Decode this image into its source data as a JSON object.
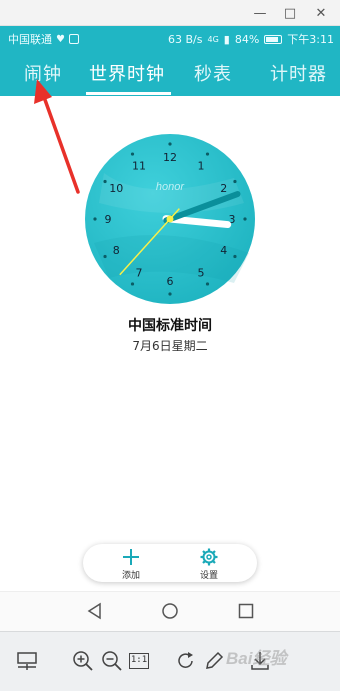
{
  "window": {
    "minimize_glyph": "—",
    "maximize_glyph": "□",
    "close_glyph": "✕"
  },
  "status_bar": {
    "carrier": "中国联通",
    "network_speed": "63 B/s",
    "signal": "4G",
    "battery": "84%",
    "time": "下午3:11"
  },
  "tabs": [
    {
      "label": "闹钟",
      "selected": false
    },
    {
      "label": "世界时钟",
      "selected": true
    },
    {
      "label": "秒表",
      "selected": false
    },
    {
      "label": "计时器",
      "selected": false
    }
  ],
  "clock": {
    "brand": "honor",
    "numbers": [
      "12",
      "1",
      "2",
      "3",
      "4",
      "5",
      "6",
      "7",
      "8",
      "9",
      "10",
      "11"
    ],
    "hour": 3,
    "minute": 11,
    "second": 37,
    "face_color": "#29c3cf",
    "hand_color": "#ffffff",
    "second_hand_color": "#f7f04a"
  },
  "zone": {
    "name": "中国标准时间",
    "date": "7月6日星期二"
  },
  "actions": {
    "add_label": "添加",
    "settings_label": "设置"
  },
  "toolbar": {
    "actual_size_label": "1:1"
  },
  "watermark": "Bai经验",
  "colors": {
    "accent": "#20b6c4",
    "annotation": "#e8312a"
  }
}
